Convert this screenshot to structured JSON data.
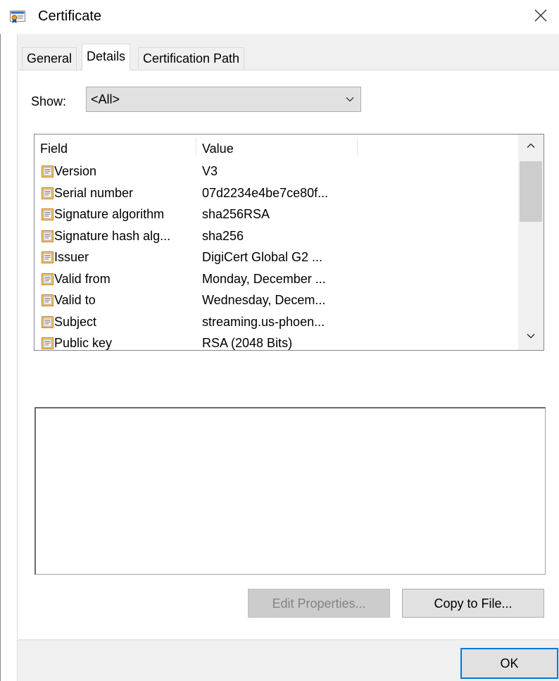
{
  "window": {
    "title": "Certificate",
    "icon": "certificate-icon"
  },
  "tabs": [
    {
      "label": "General"
    },
    {
      "label": "Details",
      "selected": true
    },
    {
      "label": "Certification Path"
    }
  ],
  "show": {
    "label": "Show:",
    "value": "<All>"
  },
  "list": {
    "columns": [
      "Field",
      "Value"
    ],
    "rows": [
      {
        "field": "Version",
        "value": "V3"
      },
      {
        "field": "Serial number",
        "value": "07d2234e4be7ce80f..."
      },
      {
        "field": "Signature algorithm",
        "value": "sha256RSA"
      },
      {
        "field": "Signature hash alg...",
        "value": "sha256"
      },
      {
        "field": "Issuer",
        "value": "DigiCert Global G2 ..."
      },
      {
        "field": "Valid from",
        "value": "Monday, December ..."
      },
      {
        "field": "Valid to",
        "value": "Wednesday, Decem..."
      },
      {
        "field": "Subject",
        "value": "streaming.us-phoen..."
      },
      {
        "field": "Public key",
        "value": "RSA (2048 Bits)"
      }
    ]
  },
  "detail_text": "",
  "buttons": {
    "edit_properties": "Edit Properties...",
    "copy_to_file": "Copy to File...",
    "ok": "OK"
  },
  "colors": {
    "dialog_background": "#f0f0f0",
    "panel_background": "#ffffff",
    "focus_border": "#0078d7",
    "disabled_text": "#838383"
  }
}
